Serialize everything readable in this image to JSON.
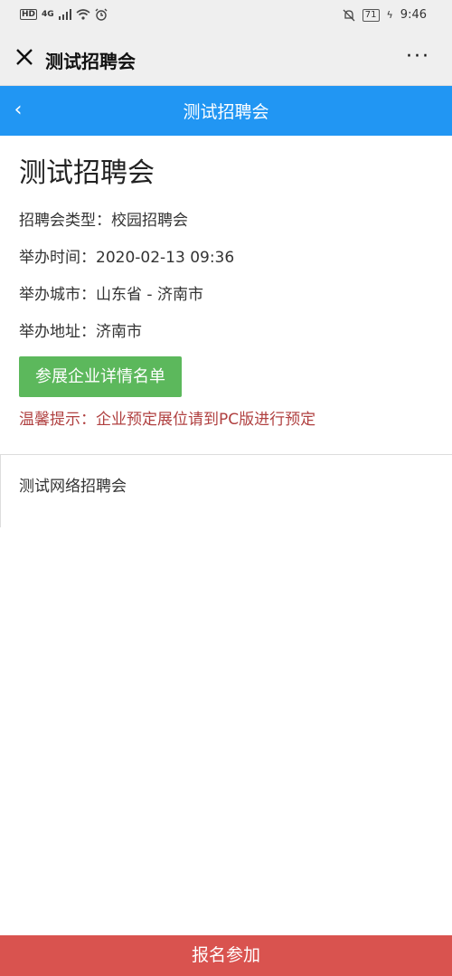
{
  "status_bar": {
    "left_icons": [
      "HD",
      "4G",
      "signal-icon",
      "wifi-icon",
      "alarm-icon"
    ],
    "network": "4G",
    "right_icons": [
      "mute-icon",
      "battery-icon",
      "charging-icon"
    ],
    "battery": "71",
    "time": "9:46"
  },
  "wechat_bar": {
    "title": "测试招聘会",
    "more": "···"
  },
  "header": {
    "back": "‹",
    "title": "测试招聘会"
  },
  "fair": {
    "title": "测试招聘会",
    "type_row": "招聘会类型：校园招聘会",
    "time_row": "举办时间：2020-02-13 09:36",
    "city_row": "举办城市：山东省 - 济南市",
    "address_row": "举办地址：济南市",
    "companies_button": "参展企业详情名单",
    "tip": "温馨提示：企业预定展位请到PC版进行预定"
  },
  "description": {
    "text": "测试网络招聘会"
  },
  "bottom": {
    "signup_button": "报名参加"
  },
  "colors": {
    "header_blue": "#2196f3",
    "button_green": "#5cb85c",
    "signup_red": "#d9534f",
    "tip_red": "#b04040"
  }
}
